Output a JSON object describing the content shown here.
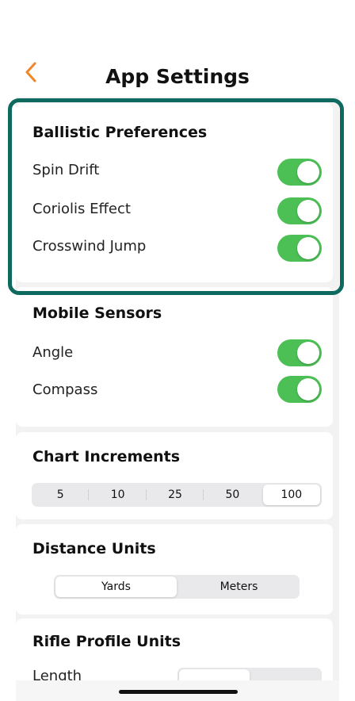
{
  "header": {
    "title": "App Settings",
    "back_icon": "chevron-left-icon",
    "back_color": "#f0852a"
  },
  "sections": {
    "ballistic": {
      "title": "Ballistic Preferences",
      "rows": [
        {
          "label": "Spin Drift",
          "on": true
        },
        {
          "label": "Coriolis Effect",
          "on": true
        },
        {
          "label": "Crosswind Jump",
          "on": true
        }
      ]
    },
    "sensors": {
      "title": "Mobile Sensors",
      "rows": [
        {
          "label": "Angle",
          "on": true
        },
        {
          "label": "Compass",
          "on": true
        }
      ]
    },
    "chart": {
      "title": "Chart Increments",
      "options": [
        "5",
        "10",
        "25",
        "50",
        "100"
      ],
      "selected": "100"
    },
    "distance": {
      "title": "Distance Units",
      "options": [
        "Yards",
        "Meters"
      ],
      "selected": "Yards"
    },
    "rifle": {
      "title": "Rifle Profile Units",
      "partial_label": "Length"
    }
  },
  "colors": {
    "toggle_on": "#4cbf55",
    "highlight": "#0e6a5e"
  }
}
